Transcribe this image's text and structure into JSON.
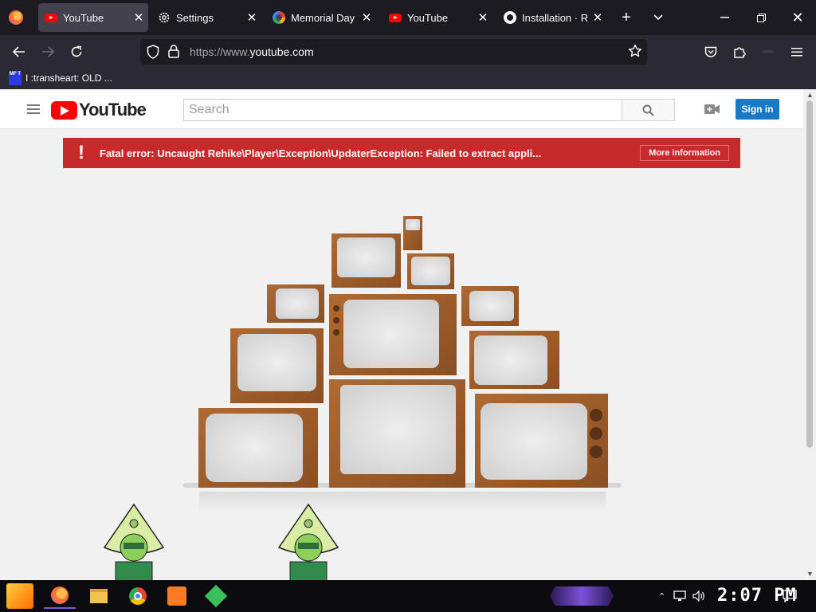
{
  "browser": {
    "tabs": [
      {
        "label": "YouTube",
        "icon": "youtube-icon",
        "active": true
      },
      {
        "label": "Settings",
        "icon": "gear-icon",
        "active": false
      },
      {
        "label": "Memorial Day -",
        "icon": "google-icon",
        "active": false
      },
      {
        "label": "YouTube",
        "icon": "youtube-icon",
        "active": false
      },
      {
        "label": "Installation · Re",
        "icon": "github-icon",
        "active": false
      }
    ],
    "url_dim_prefix": "https://www.",
    "url_main": "youtube.com",
    "bookmarks": [
      {
        "label": "I :transheart: OLD ...",
        "icon_text": "MF T"
      }
    ]
  },
  "youtube": {
    "logo_text": "YouTube",
    "search_placeholder": "Search",
    "signin_label": "Sign in",
    "error": {
      "message": "Fatal error: Uncaught Rehike\\Player\\Exception\\UpdaterException: Failed to extract appli...",
      "more_label": "More information"
    }
  },
  "taskbar": {
    "clock": "2:07 PM"
  },
  "colors": {
    "tab_bar": "#1c1b22",
    "toolbar": "#2b2a33",
    "active_tab": "#42414d",
    "youtube_red": "#ff0000",
    "error_red": "#c62a2a",
    "signin_blue": "#167ac6",
    "tv_wood": "#9c5b2b"
  }
}
